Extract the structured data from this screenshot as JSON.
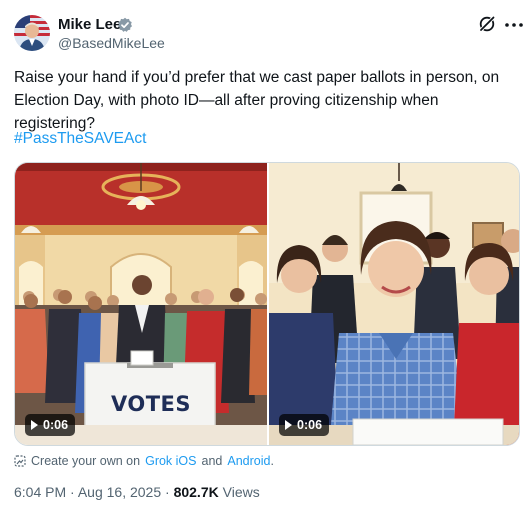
{
  "author": {
    "name": "Mike Lee",
    "handle": "@BasedMikeLee",
    "verified": true,
    "avatar_icon": "avatar-flag-portrait"
  },
  "header_icons": [
    "grok-icon",
    "more-icon"
  ],
  "tweet": {
    "text": "Raise your hand if you’d prefer that we cast paper ballots in person, on Election Day, with photo ID—all after proving citizenship when registering?",
    "hashtag": "#PassTheSAVEAct"
  },
  "media": {
    "left": {
      "label": "VOTES",
      "duration": "0:06"
    },
    "right": {
      "duration": "0:06"
    }
  },
  "promo": {
    "prefix": "Create your own on",
    "link1": "Grok iOS",
    "middle": "and",
    "link2": "Android",
    "suffix": "."
  },
  "meta": {
    "time": "6:04 PM",
    "date": "Aug 16, 2025",
    "views_count": "802.7K",
    "views_label": "Views"
  },
  "colors": {
    "accent": "#1d9bf0",
    "text": "#0f1419",
    "muted": "#536471",
    "border": "#cfd9de"
  }
}
